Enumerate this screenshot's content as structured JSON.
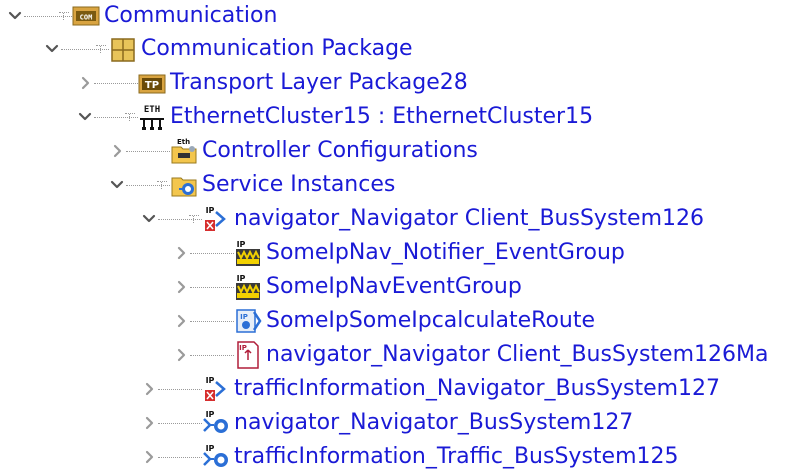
{
  "tree": {
    "nodes": [
      {
        "label": "Communication",
        "icon": "com-folder-icon",
        "state": "expanded"
      },
      {
        "label": "Communication Package",
        "icon": "package-icon",
        "state": "expanded"
      },
      {
        "label": "Transport Layer Package28",
        "icon": "tp-package-icon",
        "state": "collapsed"
      },
      {
        "label": "EthernetCluster15 : EthernetCluster15",
        "icon": "ethernet-cluster-icon",
        "state": "expanded"
      },
      {
        "label": "Controller Configurations",
        "icon": "controller-config-folder-icon",
        "state": "collapsed"
      },
      {
        "label": "Service Instances",
        "icon": "service-instances-folder-icon",
        "state": "expanded"
      },
      {
        "label": "navigator_Navigator Client_BusSystem126",
        "icon": "ip-client-service-icon",
        "state": "expanded"
      },
      {
        "label": "SomeIpNav_Notifier_EventGroup",
        "icon": "event-group-icon",
        "state": "collapsed"
      },
      {
        "label": "SomeIpNavEventGroup",
        "icon": "event-group-icon",
        "state": "collapsed"
      },
      {
        "label": "SomeIpSomeIpcalculateRoute",
        "icon": "method-icon",
        "state": "collapsed"
      },
      {
        "label": "navigator_Navigator Client_BusSystem126Ma",
        "icon": "ip-doc-icon",
        "state": "collapsed"
      },
      {
        "label": "trafficInformation_Navigator_BusSystem127",
        "icon": "ip-client-service-icon",
        "state": "collapsed"
      },
      {
        "label": "navigator_Navigator_BusSystem127",
        "icon": "ip-provided-service-icon",
        "state": "collapsed"
      },
      {
        "label": "trafficInformation_Traffic_BusSystem125",
        "icon": "ip-provided-service-icon",
        "state": "collapsed"
      }
    ]
  },
  "icon_text": {
    "com": "COM",
    "tp": "TP",
    "eth": "ETH",
    "eth_small": "Eth",
    "ip": "IP"
  },
  "colors": {
    "link": "#1a1ad6",
    "connector": "#9a9a9a",
    "chevron": "#7a7a7a",
    "folder": "#d9a441",
    "event_yellow": "#f2d100",
    "error_red": "#d62e2e",
    "info_blue": "#2b6fd6"
  }
}
